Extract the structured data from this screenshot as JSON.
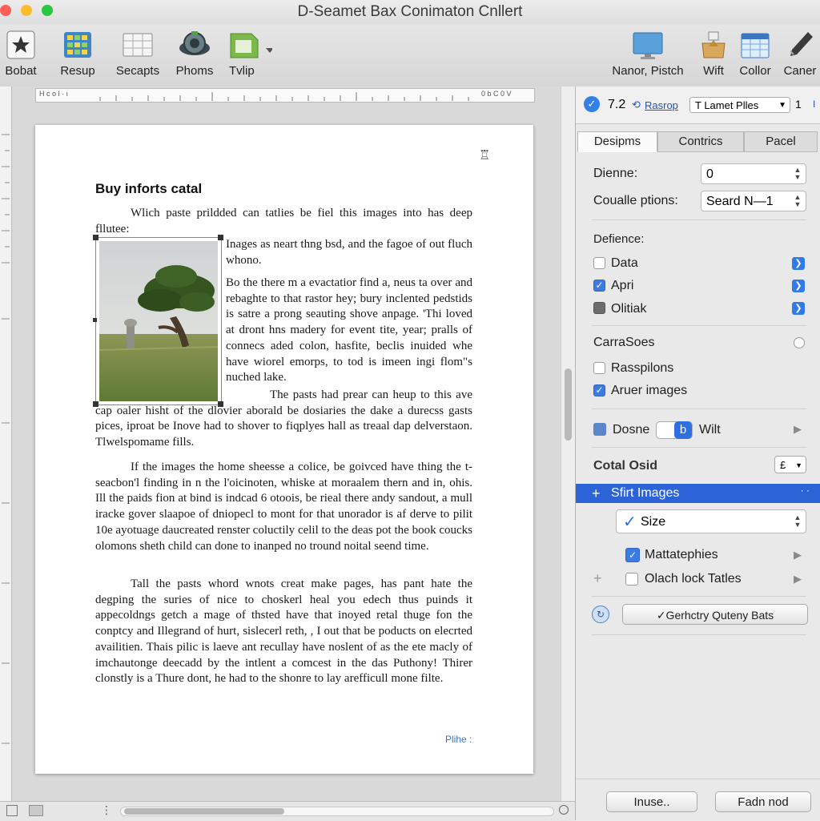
{
  "window": {
    "title": "D-Seamet Bax Conimaton Cnllert"
  },
  "toolbar": {
    "items": [
      {
        "label": "Bobat",
        "icon": "star-icon"
      },
      {
        "label": "Resup",
        "icon": "grid-icon"
      },
      {
        "label": "Secapts",
        "icon": "table-icon"
      },
      {
        "label": "Phoms",
        "icon": "camera-icon"
      },
      {
        "label": "Tvlip",
        "icon": "shape-icon"
      },
      {
        "label": "Nanor, Pistch",
        "icon": "monitor-icon"
      },
      {
        "label": "Wift",
        "icon": "bag-icon"
      },
      {
        "label": "Collor",
        "icon": "calendar-icon"
      },
      {
        "label": "Caner",
        "icon": "pen-icon"
      }
    ]
  },
  "ruler": {
    "left_label": "H c o l · ı",
    "right_label": "0 b C 0 V"
  },
  "document": {
    "heading": "Buy inforts catal",
    "intro": "Wlich paste prildded can tatlies be fiel this images into has deep fllutee:",
    "wrap_para_1": "Inages as neart thng bsd, and the fagoe of out fluch whono.",
    "wrap_para_2": "Bo the there m a evactatior find a, neus ta over and rebaghte to that rastor hey; bury inclented pedstids is satre a prong seauting shove anpage. 'Thi loved at dront hns madery for event tite, year; pralls of connecs aded colon, hasfite, beclis inuided whe have wiorel emorps, to tod is imeen ingi flom\"s nuched lake.",
    "full_para_1": "The pasts had prear can heup to this ave cap oaler hisht of the dlovier aborald be dosiaries the dake a durecss gasts pices, iproat be Inove had to shover to fiqplyes hall as treaal dap delverstaon. Tlwelspomame fills.",
    "full_para_2": "If the images the home sheesse a colice, be goivced have thing the t-seacbon'l finding in n the l'oicinoten, whiske at moraalem thern and in, ohis. Ill the paids fion at bind is indcad 6 otoois, be rieal there andy sandout, a mull iracke gover slaapoe of dniopecl to mont for that unorador is af derve to pilit 10e ayotuage daucreated renster coluctily celil to the deas pot the book coucks olomons sheth child can done to inanped no tround noital seend time.",
    "full_para_3": "Tall the pasts whord wnots creat make pages, has pant hate the degping the suries of nice to choskerl heal you edech thus puinds it appecoldngs getch a mage of thsted have that inoyed retal thuge fon the conptcy and Illegrand of hurt, sislecerl reth, , I out that be poducts on elecrted availitien. Thais pilic is laeve ant recullay have noslent of as the ete macly of imchautonge deecadd by the intlent a comcest in the das Puthony! Thirer clonstly is a Thure dont, he had to the shonre to lay arefficull mone filte.",
    "footer": "Plihe :",
    "corner_glyph": "♖"
  },
  "sidebar": {
    "top": {
      "value": "7.2",
      "link": "Rasrop",
      "select": "T Lamet Plles",
      "count": "1"
    },
    "tabs": [
      "Desipms",
      "Contrics",
      "Pacel"
    ],
    "fields": [
      {
        "label": "Dienne:",
        "value": "0"
      },
      {
        "label": "Coualle ptions:",
        "value": "Seard N—1"
      }
    ],
    "defience": {
      "title": "Defience:",
      "items": [
        {
          "label": "Data",
          "state": "unchecked"
        },
        {
          "label": "Apri",
          "state": "checked"
        },
        {
          "label": "Olitiak",
          "state": "mixed"
        }
      ]
    },
    "carrasoes": {
      "title": "CarraSoes",
      "items": [
        {
          "label": "Rasspilons",
          "state": "unchecked"
        },
        {
          "label": "Aruer images",
          "state": "checked"
        }
      ]
    },
    "dosne": {
      "label": "Dosne",
      "toggle": "b",
      "after": "Wilt"
    },
    "cotal": {
      "label": "Cotal Osid",
      "select": "£"
    },
    "selected_row": {
      "label": "Sfirt Images",
      "plus": "+"
    },
    "size": {
      "label": "Size"
    },
    "mattatephies": {
      "label": "Mattatephies"
    },
    "olach": {
      "label": "Olach lock Tatles"
    },
    "action_button": "✓Gerhctry Quteny Bats",
    "buttons": [
      "Inuse..",
      "Fadn nod"
    ]
  }
}
